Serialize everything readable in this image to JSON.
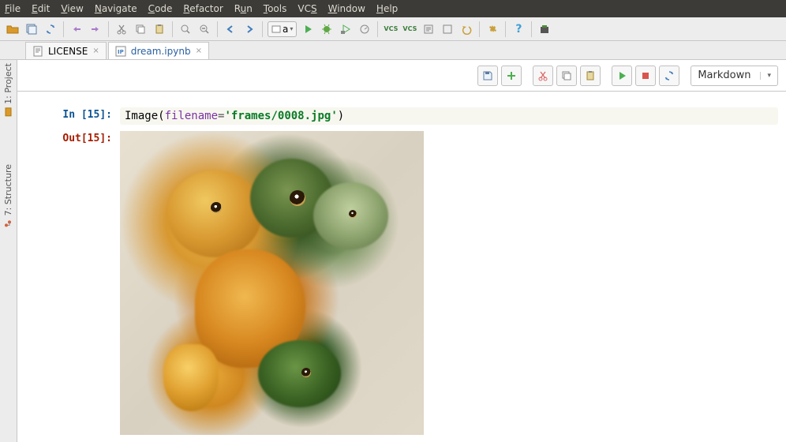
{
  "menu": {
    "file": "File",
    "edit": "Edit",
    "view": "View",
    "navigate": "Navigate",
    "code": "Code",
    "refactor": "Refactor",
    "run": "Run",
    "tools": "Tools",
    "vcs": "VCS",
    "window": "Window",
    "help": "Help"
  },
  "toolbar_combo": "a",
  "tabs": [
    {
      "label": "LICENSE",
      "type": "txt",
      "active": false
    },
    {
      "label": "dream.ipynb",
      "type": "ipynb",
      "active": true
    }
  ],
  "side_tools": {
    "project": "1: Project",
    "structure": "7: Structure"
  },
  "notebook_toolbar": {
    "cell_type": "Markdown"
  },
  "cell": {
    "in_prompt": "In [15]:",
    "out_prompt": "Out[15]:",
    "code": {
      "func": "Image",
      "kwarg": "filename",
      "eq": "=",
      "str": "'frames/0008.jpg'"
    }
  },
  "icons": {
    "open": "open-folder-icon",
    "save": "save-icon",
    "sync": "sync-icon",
    "undo": "undo-icon",
    "redo": "redo-icon",
    "cut": "cut-icon",
    "copy": "copy-icon",
    "paste": "paste-icon",
    "find": "find-icon",
    "replace": "replace-icon",
    "back": "back-icon",
    "forward": "forward-icon",
    "run": "run-icon",
    "debug": "debug-icon",
    "coverage": "coverage-icon",
    "profile": "profile-icon",
    "stop": "stop-icon",
    "vcs_update": "vcs-update-icon",
    "vcs_commit": "vcs-commit-icon",
    "history": "history-icon",
    "revert": "revert-icon",
    "settings": "settings-icon",
    "help": "help-icon",
    "python_console": "python-console-icon"
  },
  "colors": {
    "menubar_bg": "#3c3b37",
    "menubar_fg": "#dfdbd2",
    "in_prompt": "#0b5394",
    "out_prompt": "#a61c00",
    "string": "#0a7c26",
    "keyword": "#7a33a3"
  }
}
